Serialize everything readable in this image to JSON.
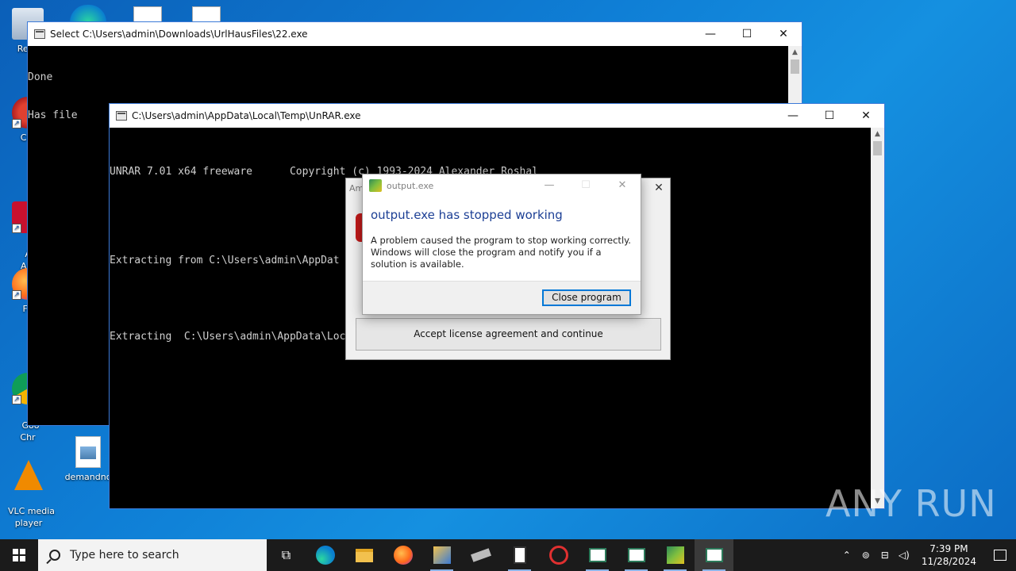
{
  "desktop": {
    "icons": [
      {
        "name": "recycle-bin",
        "label": "Recy"
      },
      {
        "name": "ccleaner",
        "label": "CCl"
      },
      {
        "name": "adobe-acrobat",
        "label": "Ad\nAcr"
      },
      {
        "name": "firefox",
        "label": "Fir"
      },
      {
        "name": "google-chrome",
        "label": "Goo\nChr"
      },
      {
        "name": "vlc",
        "label": "VLC media\nplayer"
      },
      {
        "name": "demandno",
        "label": "demandno"
      }
    ]
  },
  "console1": {
    "title": "Select C:\\Users\\admin\\Downloads\\UrlHausFiles\\22.exe",
    "lines": [
      "Done",
      "Has file"
    ]
  },
  "console2": {
    "title": "C:\\Users\\admin\\AppData\\Local\\Temp\\UnRAR.exe",
    "line1": "UNRAR 7.01 x64 freeware      Copyright (c) 1993-2024 Alexander Roshal",
    "line2": "Extracting from C:\\Users\\admin\\AppDat",
    "line3": "Extracting  C:\\Users\\admin\\AppData\\Loc"
  },
  "license_dialog": {
    "title": "Am",
    "accept_label": "Accept license agreement and continue"
  },
  "error_dialog": {
    "title": "output.exe",
    "heading": "output.exe has stopped working",
    "message": "A problem caused the program to stop working correctly. Windows will close the program and notify you if a solution is available.",
    "close_label": "Close program"
  },
  "taskbar": {
    "search_placeholder": "Type here to search",
    "time": "7:39 PM",
    "date": "11/28/2024"
  },
  "watermark": "ANY RUN"
}
